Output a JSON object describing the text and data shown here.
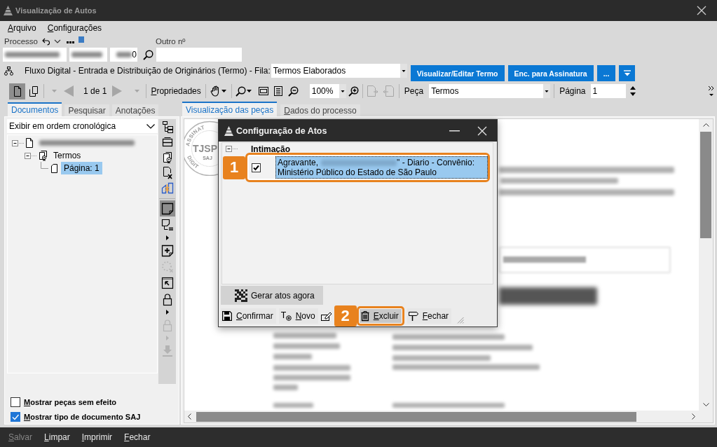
{
  "window": {
    "title": "Visualização de Autos"
  },
  "menu": [
    {
      "label": "Arquivo"
    },
    {
      "label": "Configurações"
    }
  ],
  "process": {
    "label": "Processo",
    "number_tail": "0",
    "other_label": "Outro nº"
  },
  "workflow": {
    "text": "Fluxo Digital - Entrada e Distribuição de Originários (Termo) - Fila:",
    "queue": "Termos Elaborados",
    "buttons": [
      {
        "kind": "text",
        "label": "Visualizar/Editar Termo"
      },
      {
        "kind": "text",
        "label": "Enc. para Assinatura"
      },
      {
        "kind": "text",
        "label": "..."
      },
      {
        "kind": "icon"
      }
    ]
  },
  "toolbar": {
    "view_modes": [
      {
        "selected": true
      },
      {
        "selected": false
      }
    ],
    "nav_buttons": [
      {
        "disabled": true
      },
      {
        "disabled": true
      }
    ],
    "page_counter": "1 de 1",
    "properties": "Propriedades",
    "zoom": "100%",
    "page_tools": [
      {
        "disabled": true
      },
      {
        "disabled": true
      }
    ],
    "piece_label": "Peça",
    "piece": "Termos",
    "page_label": "Página",
    "page": "1"
  },
  "documents_panel": {
    "tabs": [
      {
        "label": "Documentos",
        "selected": true
      },
      {
        "label": "Pesquisar",
        "selected": false
      },
      {
        "label": "Anotações",
        "selected": false
      }
    ],
    "order": "Exibir em ordem cronológica",
    "tree": [
      {
        "kind": "process",
        "expanded": true,
        "selected": false,
        "children": [
          {
            "kind": "group",
            "label": "Termos",
            "expanded": true,
            "selected": false,
            "children": [
              {
                "kind": "page",
                "label": "Página: 1",
                "selected": true
              }
            ]
          }
        ]
      }
    ],
    "tools": [
      {
        "selected": false,
        "disabled": false
      },
      {
        "selected": false,
        "disabled": false
      },
      {
        "selected": false,
        "disabled": false
      },
      {
        "selected": false,
        "disabled": false
      },
      {
        "selected": false,
        "disabled": false
      },
      {
        "selected": true,
        "disabled": false
      },
      {
        "selected": false,
        "disabled": false
      },
      {
        "selected": false,
        "disabled": false
      },
      {
        "selected": false,
        "disabled": true
      },
      {
        "selected": false,
        "disabled": false
      },
      {
        "selected": false,
        "disabled": false
      },
      {
        "selected": false,
        "disabled": true
      },
      {
        "selected": false,
        "disabled": true
      }
    ],
    "options": [
      {
        "label": "Mostrar peças sem efeito",
        "checked": false
      },
      {
        "label": "Mostrar tipo de documento SAJ",
        "checked": true
      }
    ]
  },
  "viewer": {
    "tabs": [
      {
        "label": "Visualização das peças",
        "selected": true,
        "accel": false
      },
      {
        "label": "Dados do processo",
        "selected": false,
        "accel": true
      }
    ],
    "seal": {
      "arc_top": "ASSINAT",
      "center": "TJSP",
      "bottom": "SAJ",
      "arc_bottom": "DIGIT"
    }
  },
  "dialog": {
    "title": "Configuração de Atos",
    "group": {
      "label": "Intimação",
      "expanded": true
    },
    "acts": [
      {
        "checked": true,
        "selected": true,
        "description_before": "Agravante,",
        "description_after": "\" - Diario - Convênio: Ministério Público do Estado de São Paulo",
        "callout": "1"
      }
    ],
    "generate_button": "Gerar atos agora",
    "actions": [
      {
        "kind": "text",
        "label": "Confirmar",
        "highlighted": false
      },
      {
        "kind": "text",
        "label": "Novo",
        "highlighted": false
      },
      {
        "kind": "icon",
        "highlighted": false
      },
      {
        "kind": "text",
        "label": "Excluir",
        "highlighted": true,
        "callout": "2"
      },
      {
        "kind": "text",
        "label": "Fechar",
        "highlighted": false
      }
    ]
  },
  "bottom_bar": [
    {
      "label": "Salvar",
      "disabled": true
    },
    {
      "label": "Limpar",
      "disabled": false
    },
    {
      "label": "Imprimir",
      "disabled": false
    },
    {
      "label": "Fechar",
      "disabled": false
    }
  ]
}
